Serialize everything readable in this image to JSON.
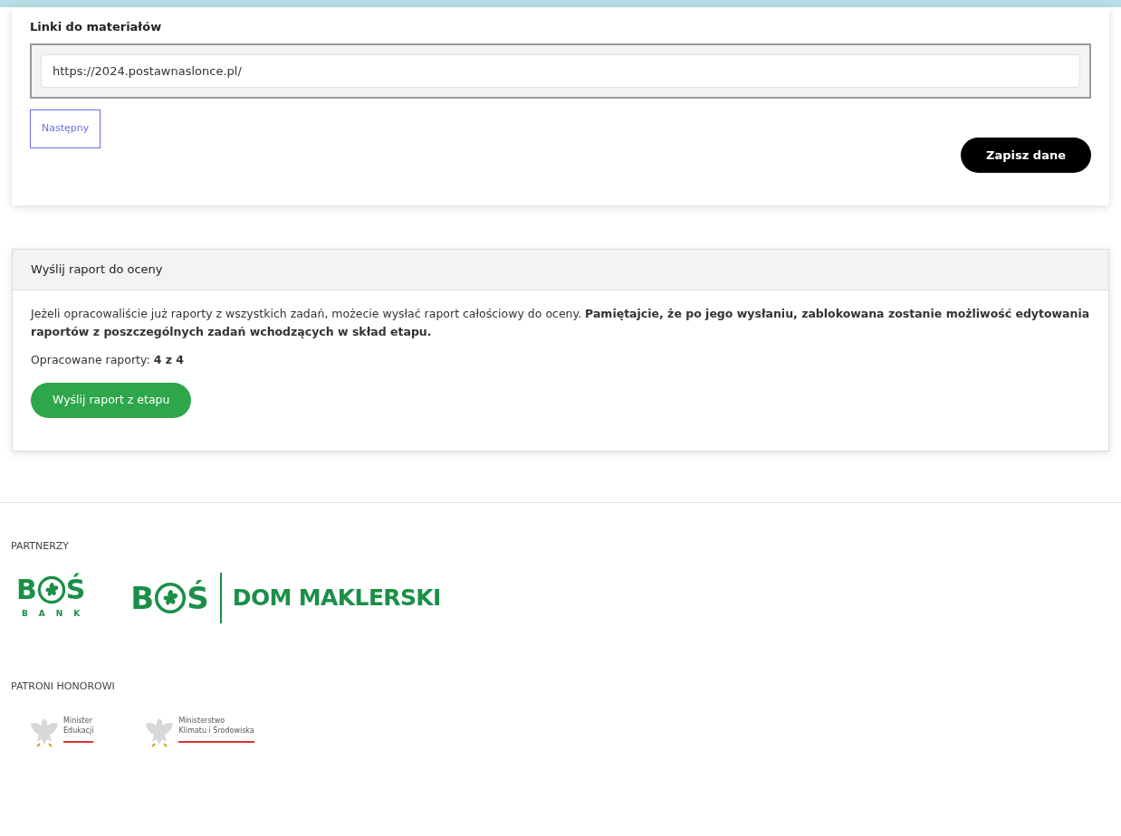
{
  "links_section": {
    "label": "Linki do materiałów",
    "value": "https://2024.postawnaslonce.pl/",
    "next_button": "Następny",
    "save_button": "Zapisz dane"
  },
  "report_panel": {
    "title": "Wyślij raport do oceny",
    "description": "Jeżeli opracowaliście już raporty z wszystkich zadań, możecie wysłać raport całościowy do oceny. **Pamiętajcie, że po jego wysłaniu, zablokowana zostanie możliwość edytowania raportów z poszczególnych zadań wchodzących w skład etapu.**",
    "progress": "Opracowane raporty: **4 z 4**",
    "submit_button": "Wyślij raport z etapu"
  },
  "footer": {
    "partners_heading": "PARTNERZY",
    "partners": [
      {
        "kind": "bank",
        "letter_1": "B",
        "letter_2": "Ś",
        "caption": "BANK"
      },
      {
        "kind": "brokerage",
        "letter_1": "B",
        "letter_2": "Ś",
        "caption": "DOM MAKLERSKI"
      }
    ],
    "patrons_heading": "PATRONI HONOROWI",
    "patrons": [
      {
        "lines": [
          "Minister",
          "Edukacji"
        ]
      },
      {
        "lines": [
          "Ministerstwo",
          "Klimatu i Środowiska"
        ]
      }
    ]
  }
}
